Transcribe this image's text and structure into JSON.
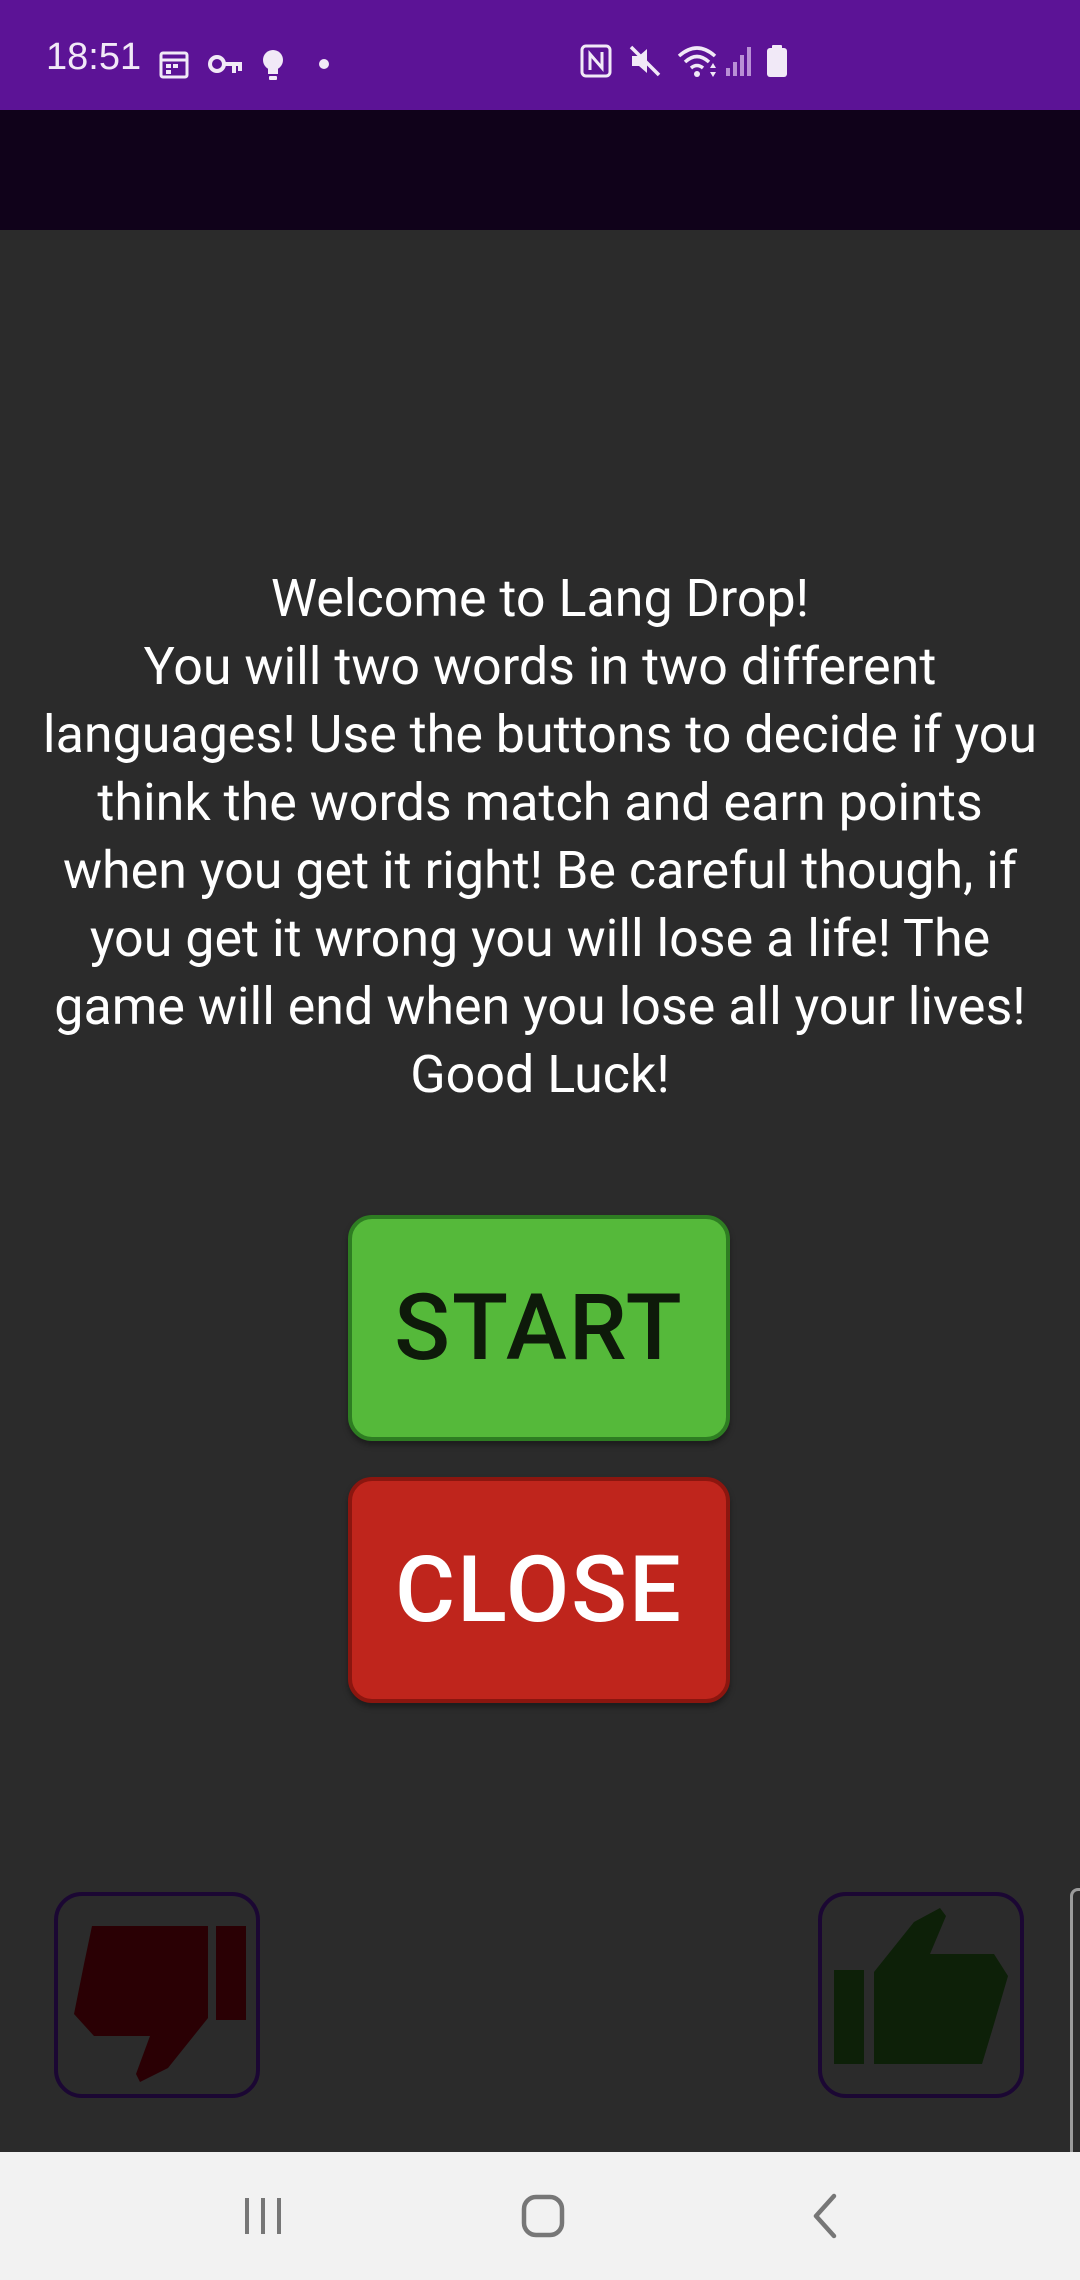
{
  "status_bar": {
    "time": "18:51",
    "left_icons": [
      "calendar-icon",
      "key-icon",
      "lightbulb-icon",
      "dot-icon"
    ],
    "right_icons": [
      "nfc-icon",
      "mute-icon",
      "wifi-icon",
      "signal-icon",
      "battery-icon"
    ],
    "background_color": "#5c1396"
  },
  "app_bar": {
    "background_color": "#10021a"
  },
  "welcome": {
    "text": "Welcome to Lang Drop!\nYou will two words in two different languages! Use the buttons to decide if you think the words match and earn points when you get it right! Be careful though, if you get it wrong you will lose a life! The game will end when you lose all your lives!\nGood Luck!"
  },
  "buttons": {
    "start_label": "START",
    "close_label": "CLOSE",
    "start_color": "#55b93a",
    "close_color": "#bf251c"
  },
  "vote_buttons": {
    "dislike_icon": "thumbs-down-icon",
    "like_icon": "thumbs-up-icon",
    "dislike_color": "#2a0004",
    "like_color": "#0d2008"
  },
  "nav_bar": {
    "items": [
      "recents-icon",
      "home-icon",
      "back-icon"
    ]
  }
}
